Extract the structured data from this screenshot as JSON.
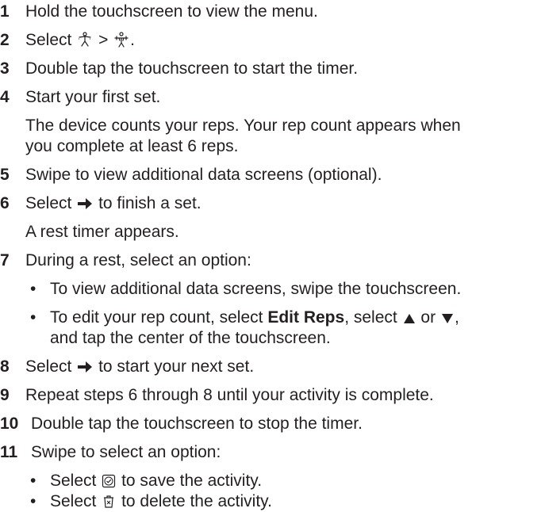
{
  "steps": [
    {
      "num": "1",
      "text": "Hold the touchscreen to view the menu."
    },
    {
      "num": "2",
      "pre": "Select",
      "sep": ">",
      "post": "."
    },
    {
      "num": "3",
      "text": "Double tap the touchscreen to start the timer."
    },
    {
      "num": "4",
      "text": "Start your first set.",
      "para_line1": "The device counts your reps. Your rep count appears when",
      "para_line2": "you complete at least 6 reps."
    },
    {
      "num": "5",
      "text": "Swipe to view additional data screens (optional)."
    },
    {
      "num": "6",
      "pre": "Select",
      "post": "to finish a set.",
      "para": "A rest timer appears."
    },
    {
      "num": "7",
      "text": "During a rest, select an option:",
      "bullet1": "To view additional data screens, swipe the touchscreen.",
      "bullet2_pre": "To edit your rep count, select",
      "bullet2_bold": "Edit Reps",
      "bullet2_mid": ", select",
      "bullet2_or": "or",
      "bullet2_end": ",",
      "bullet2_line2": "and tap the center of the touchscreen."
    },
    {
      "num": "8",
      "pre": "Select",
      "post": "to start your next set."
    },
    {
      "num": "9",
      "text": "Repeat steps 6 through 8 until your activity is complete."
    },
    {
      "num": "10",
      "text": "Double tap the touchscreen to stop the timer."
    },
    {
      "num": "11",
      "text": "Swipe to select an option:",
      "bullet1_pre": "Select",
      "bullet1_post": "to save the activity.",
      "bullet2_pre": "Select",
      "bullet2_post": "to delete the activity."
    }
  ],
  "bullet_char": "•",
  "icons": {
    "activity": "activity-run-icon",
    "strength": "strength-training-icon",
    "arrow": "right-arrow-icon",
    "up": "triangle-up-icon",
    "down": "triangle-down-icon",
    "save": "save-checkmark-icon",
    "delete": "delete-trash-icon"
  },
  "colors": {
    "text": "#231f20"
  }
}
